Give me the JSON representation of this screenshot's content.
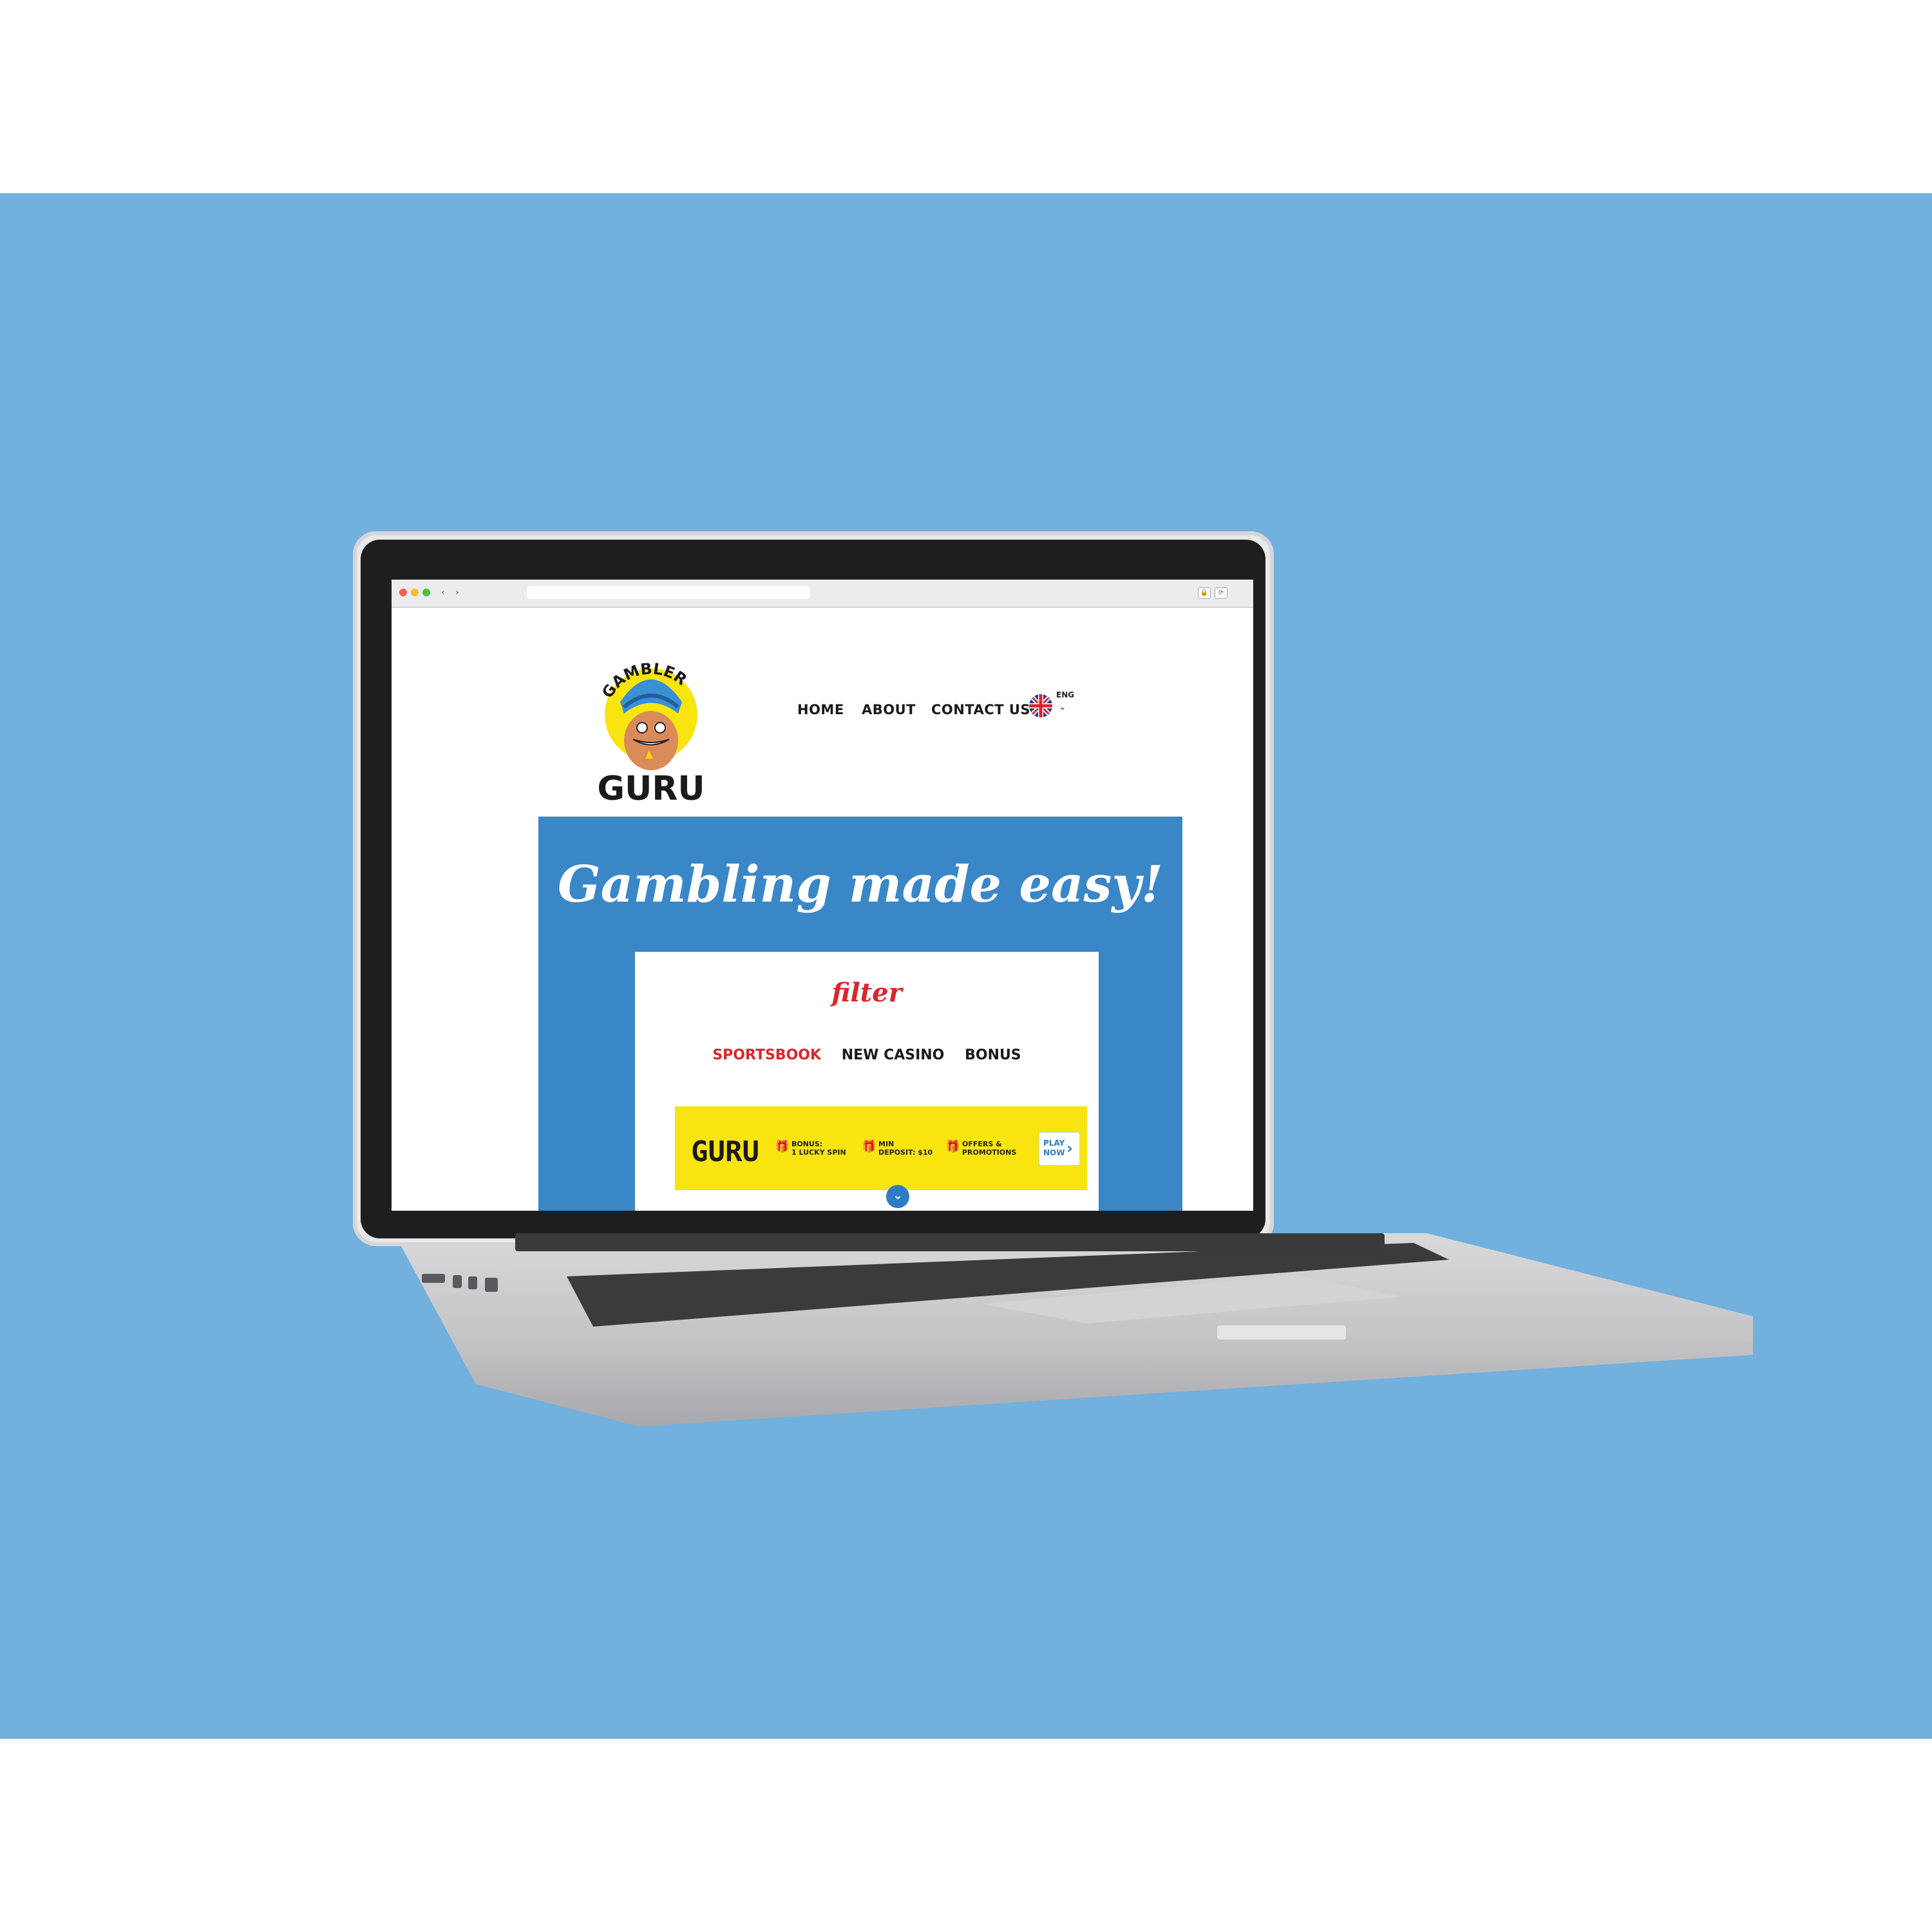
{
  "colors": {
    "backdrop": "#72b0de",
    "hero": "#3a87c8",
    "accent_red": "#d9262c",
    "offer_yellow": "#f8e40f",
    "link_blue": "#2f7bc6"
  },
  "browser": {
    "window_controls": [
      "close-dot",
      "minimize-dot",
      "maximize-dot"
    ],
    "back_glyph": "‹",
    "forward_glyph": "›",
    "lock_glyph": "🔒",
    "reload_glyph": "⟳"
  },
  "site": {
    "logo": {
      "top_text": "GAMBLER",
      "bottom_text": "GURU"
    },
    "nav": {
      "home": "HOME",
      "about": "ABOUT",
      "contact": "CONTACT US",
      "language": "ENG",
      "language_chevron": "⌄"
    },
    "hero": {
      "title": "Gambling made easy!"
    },
    "filter": {
      "title": "filter",
      "tabs": [
        {
          "label": "SPORTSBOOK",
          "active": true
        },
        {
          "label": "NEW CASINO",
          "active": false
        },
        {
          "label": "BONUS",
          "active": false
        }
      ]
    },
    "offer": {
      "brand": "GURU",
      "items": [
        {
          "icon": "gift-icon",
          "line1": "BONUS:",
          "line2": "1 LUCKY SPIN"
        },
        {
          "icon": "gift-icon",
          "line1": "MIN",
          "line2": "DEPOSIT: $10"
        },
        {
          "icon": "gift-icon",
          "line1": "OFFERS &",
          "line2": "PROMOTIONS"
        }
      ],
      "cta": {
        "line1": "PLAY",
        "line2": "NOW",
        "chevron": "›"
      },
      "expand_glyph": "⌄"
    }
  }
}
